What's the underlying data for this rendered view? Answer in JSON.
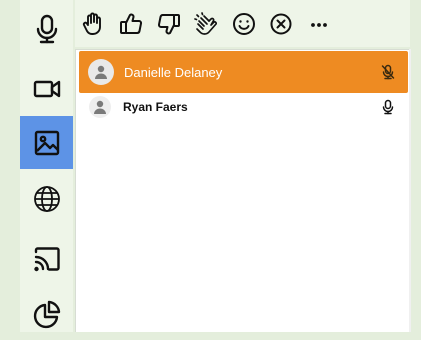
{
  "sidebar": {
    "items": [
      {
        "icon": "microphone-icon"
      },
      {
        "icon": "video-camera-icon"
      },
      {
        "icon": "image-icon",
        "active": true
      },
      {
        "icon": "globe-icon"
      },
      {
        "icon": "cast-icon"
      },
      {
        "icon": "pie-chart-icon"
      }
    ]
  },
  "toolbar": {
    "items": [
      {
        "icon": "raise-hand-icon"
      },
      {
        "icon": "thumbs-up-icon"
      },
      {
        "icon": "thumbs-down-icon"
      },
      {
        "icon": "clap-icon"
      },
      {
        "icon": "smiley-icon"
      },
      {
        "icon": "clear-reactions-icon"
      },
      {
        "icon": "more-options-icon"
      }
    ]
  },
  "participants": [
    {
      "name": "Danielle Delaney",
      "mic": "muted",
      "selected": true
    },
    {
      "name": "Ryan Faers",
      "mic": "on",
      "selected": false
    }
  ],
  "colors": {
    "accent": "#ee8b22",
    "active_side": "#5d93e6",
    "background": "#e4eedc"
  }
}
